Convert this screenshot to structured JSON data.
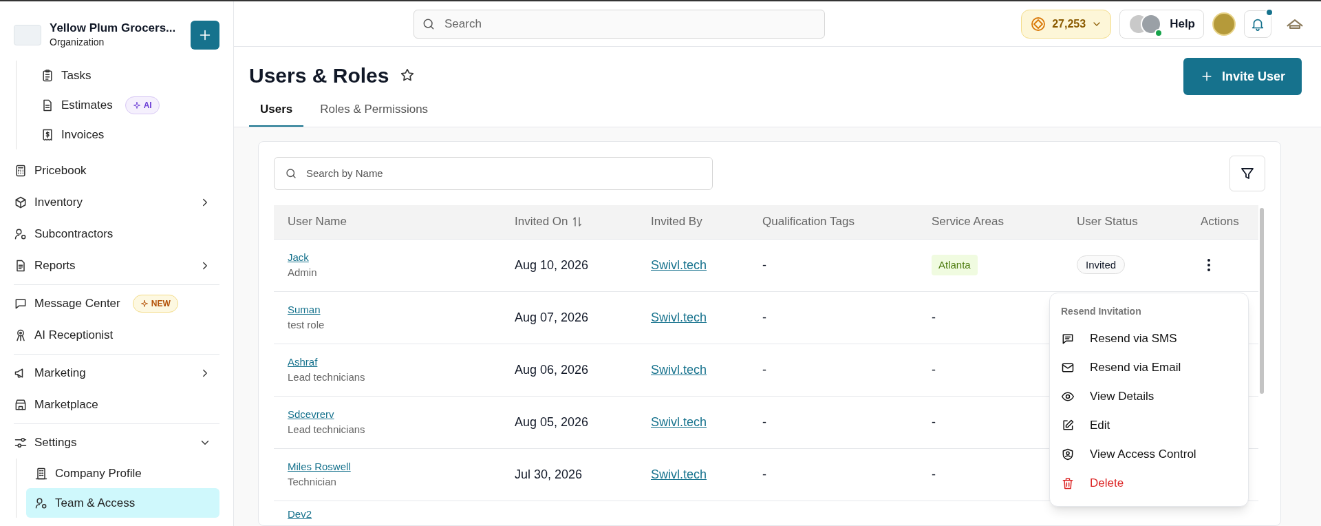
{
  "sidebar": {
    "org_name": "Yellow Plum Grocers...",
    "org_type": "Organization",
    "sections": [
      [
        {
          "label": "Tasks",
          "sub": true
        },
        {
          "label": "Estimates",
          "sub": true,
          "badge": {
            "text": "AI",
            "kind": "ai"
          }
        },
        {
          "label": "Invoices",
          "sub": true
        },
        {
          "label": "Pricebook"
        },
        {
          "label": "Inventory",
          "expanded": false
        },
        {
          "label": "Subcontractors"
        },
        {
          "label": "Reports",
          "expanded": false
        }
      ],
      [
        {
          "label": "Message Center",
          "badge": {
            "text": "NEW",
            "kind": "new"
          }
        },
        {
          "label": "AI Receptionist"
        }
      ],
      [
        {
          "label": "Marketing",
          "expanded": false
        },
        {
          "label": "Marketplace"
        }
      ],
      [
        {
          "label": "Settings",
          "expanded": true,
          "children": [
            {
              "label": "Company Profile",
              "selected": false
            },
            {
              "label": "Team & Access",
              "selected": true
            }
          ]
        }
      ]
    ]
  },
  "top_bar": {
    "search_placeholder": "Search",
    "coins": "27,253",
    "help": "Help",
    "notification_dot": true
  },
  "page": {
    "title": "Users & Roles",
    "starred": false,
    "invite_button": "Invite User",
    "tabs": [
      {
        "label": "Users",
        "selected": true
      },
      {
        "label": "Roles & Permissions",
        "selected": false
      }
    ]
  },
  "table": {
    "search_placeholder": "Search by Name",
    "columns": [
      {
        "label": "User Name",
        "sortable": false
      },
      {
        "label": "Invited On",
        "sortable": true
      },
      {
        "label": "Invited By",
        "sortable": false
      },
      {
        "label": "Qualification Tags",
        "sortable": false
      },
      {
        "label": "Service Areas",
        "sortable": false
      },
      {
        "label": "User Status",
        "sortable": false
      },
      {
        "label": "Actions",
        "sortable": false
      }
    ],
    "rows": [
      {
        "name": "Jack",
        "role": "Admin",
        "invited_on": "Aug 10, 2026",
        "invited_by": "Swivl.tech",
        "qualification_tags": "-",
        "service_areas": [
          {
            "text": "Atlanta"
          }
        ],
        "status": "Invited"
      },
      {
        "name": "Suman",
        "role": "test role",
        "invited_on": "Aug 07, 2026",
        "invited_by": "Swivl.tech",
        "qualification_tags": "-",
        "service_areas_text": "-"
      },
      {
        "name": "Ashraf",
        "role": "Lead technicians",
        "invited_on": "Aug 06, 2026",
        "invited_by": "Swivl.tech",
        "qualification_tags": "-",
        "service_areas_text": "-"
      },
      {
        "name": "Sdcevrerv",
        "role": "Lead technicians",
        "invited_on": "Aug 05, 2026",
        "invited_by": "Swivl.tech",
        "qualification_tags": "-",
        "service_areas_text": "-"
      },
      {
        "name": "Miles Roswell",
        "role": "Technician",
        "invited_on": "Jul 30, 2026",
        "invited_by": "Swivl.tech",
        "qualification_tags": "-",
        "service_areas_text": "-"
      },
      {
        "name": "Dev2"
      }
    ]
  },
  "actions_menu": {
    "heading": "Resend Invitation",
    "items": [
      {
        "label": "Resend via SMS",
        "kind": "normal"
      },
      {
        "label": "Resend via Email",
        "kind": "normal"
      },
      {
        "label": "View Details",
        "kind": "normal"
      },
      {
        "label": "Edit",
        "kind": "normal"
      },
      {
        "label": "View Access Control",
        "kind": "normal"
      },
      {
        "label": "Delete",
        "kind": "danger"
      }
    ]
  }
}
